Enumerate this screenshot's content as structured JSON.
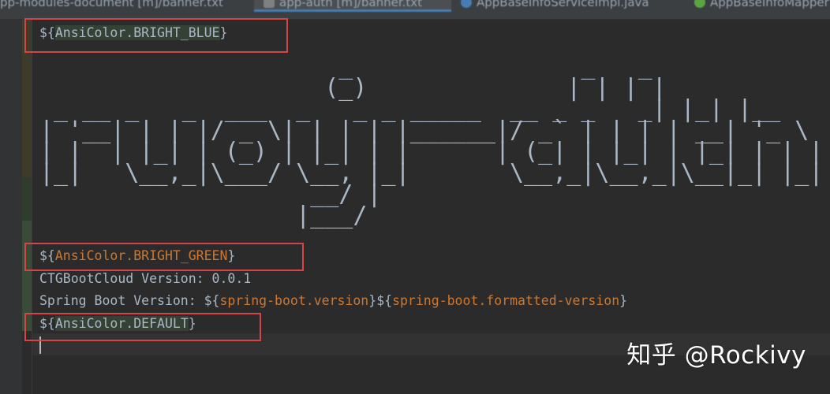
{
  "tabs": [
    {
      "label": "pp-modules-document [m]/banner.txt",
      "icon": "text-file-icon",
      "active": false
    },
    {
      "label": "app-auth [m]/banner.txt",
      "icon": "text-file-icon",
      "active": true
    },
    {
      "label": "AppBaseInfoServiceImpl.java",
      "icon": "class-icon",
      "active": false
    },
    {
      "label": "AppBaseInfoMapper",
      "icon": "interface-icon",
      "active": false
    }
  ],
  "editor": {
    "line_blue": {
      "prefix": "${",
      "key": "AnsiColor.BRIGHT_BLUE",
      "suffix": "}"
    },
    "ascii_art": [
      "                     _                _   _",
      "                    (_)              | | | |",
      " _ __ _   _  ___  _   _ _ _____  __ _ _   _| |_| |__",
      "| '__| | | |/ _ \\| | | | |______|/ _` | | | | __| '_ \\",
      "| |  | |_| | (_) | |_| | |      | (_| | |_| | |_| | | |",
      "|_|   \\__,_|\\___/ \\__, |_|       \\__,_|\\__,_|\\__|_| |_|",
      "                   __/ |",
      "                  |___/"
    ],
    "line_green": {
      "prefix": "${",
      "key": "AnsiColor.BRIGHT_GREEN",
      "suffix": "}"
    },
    "version_line": "CTGBootCloud Version: 0.0.1",
    "spring_line": {
      "prefix": "Spring Boot Version: ",
      "var1_open": "${",
      "var1": "spring-boot.version",
      "var1_close": "}",
      "var2_open": "${",
      "var2": "spring-boot.formatted-version",
      "var2_close": "}"
    },
    "line_default": {
      "prefix": "${",
      "key": "AnsiColor.DEFAULT",
      "suffix": "}"
    }
  },
  "watermark": "知乎 @Rockivy",
  "colors": {
    "background": "#2b2b2b",
    "text": "#a9b7c6",
    "keyword": "#cc7832",
    "annotation_box": "#d64545",
    "active_tab_underline": "#4a88c7"
  }
}
